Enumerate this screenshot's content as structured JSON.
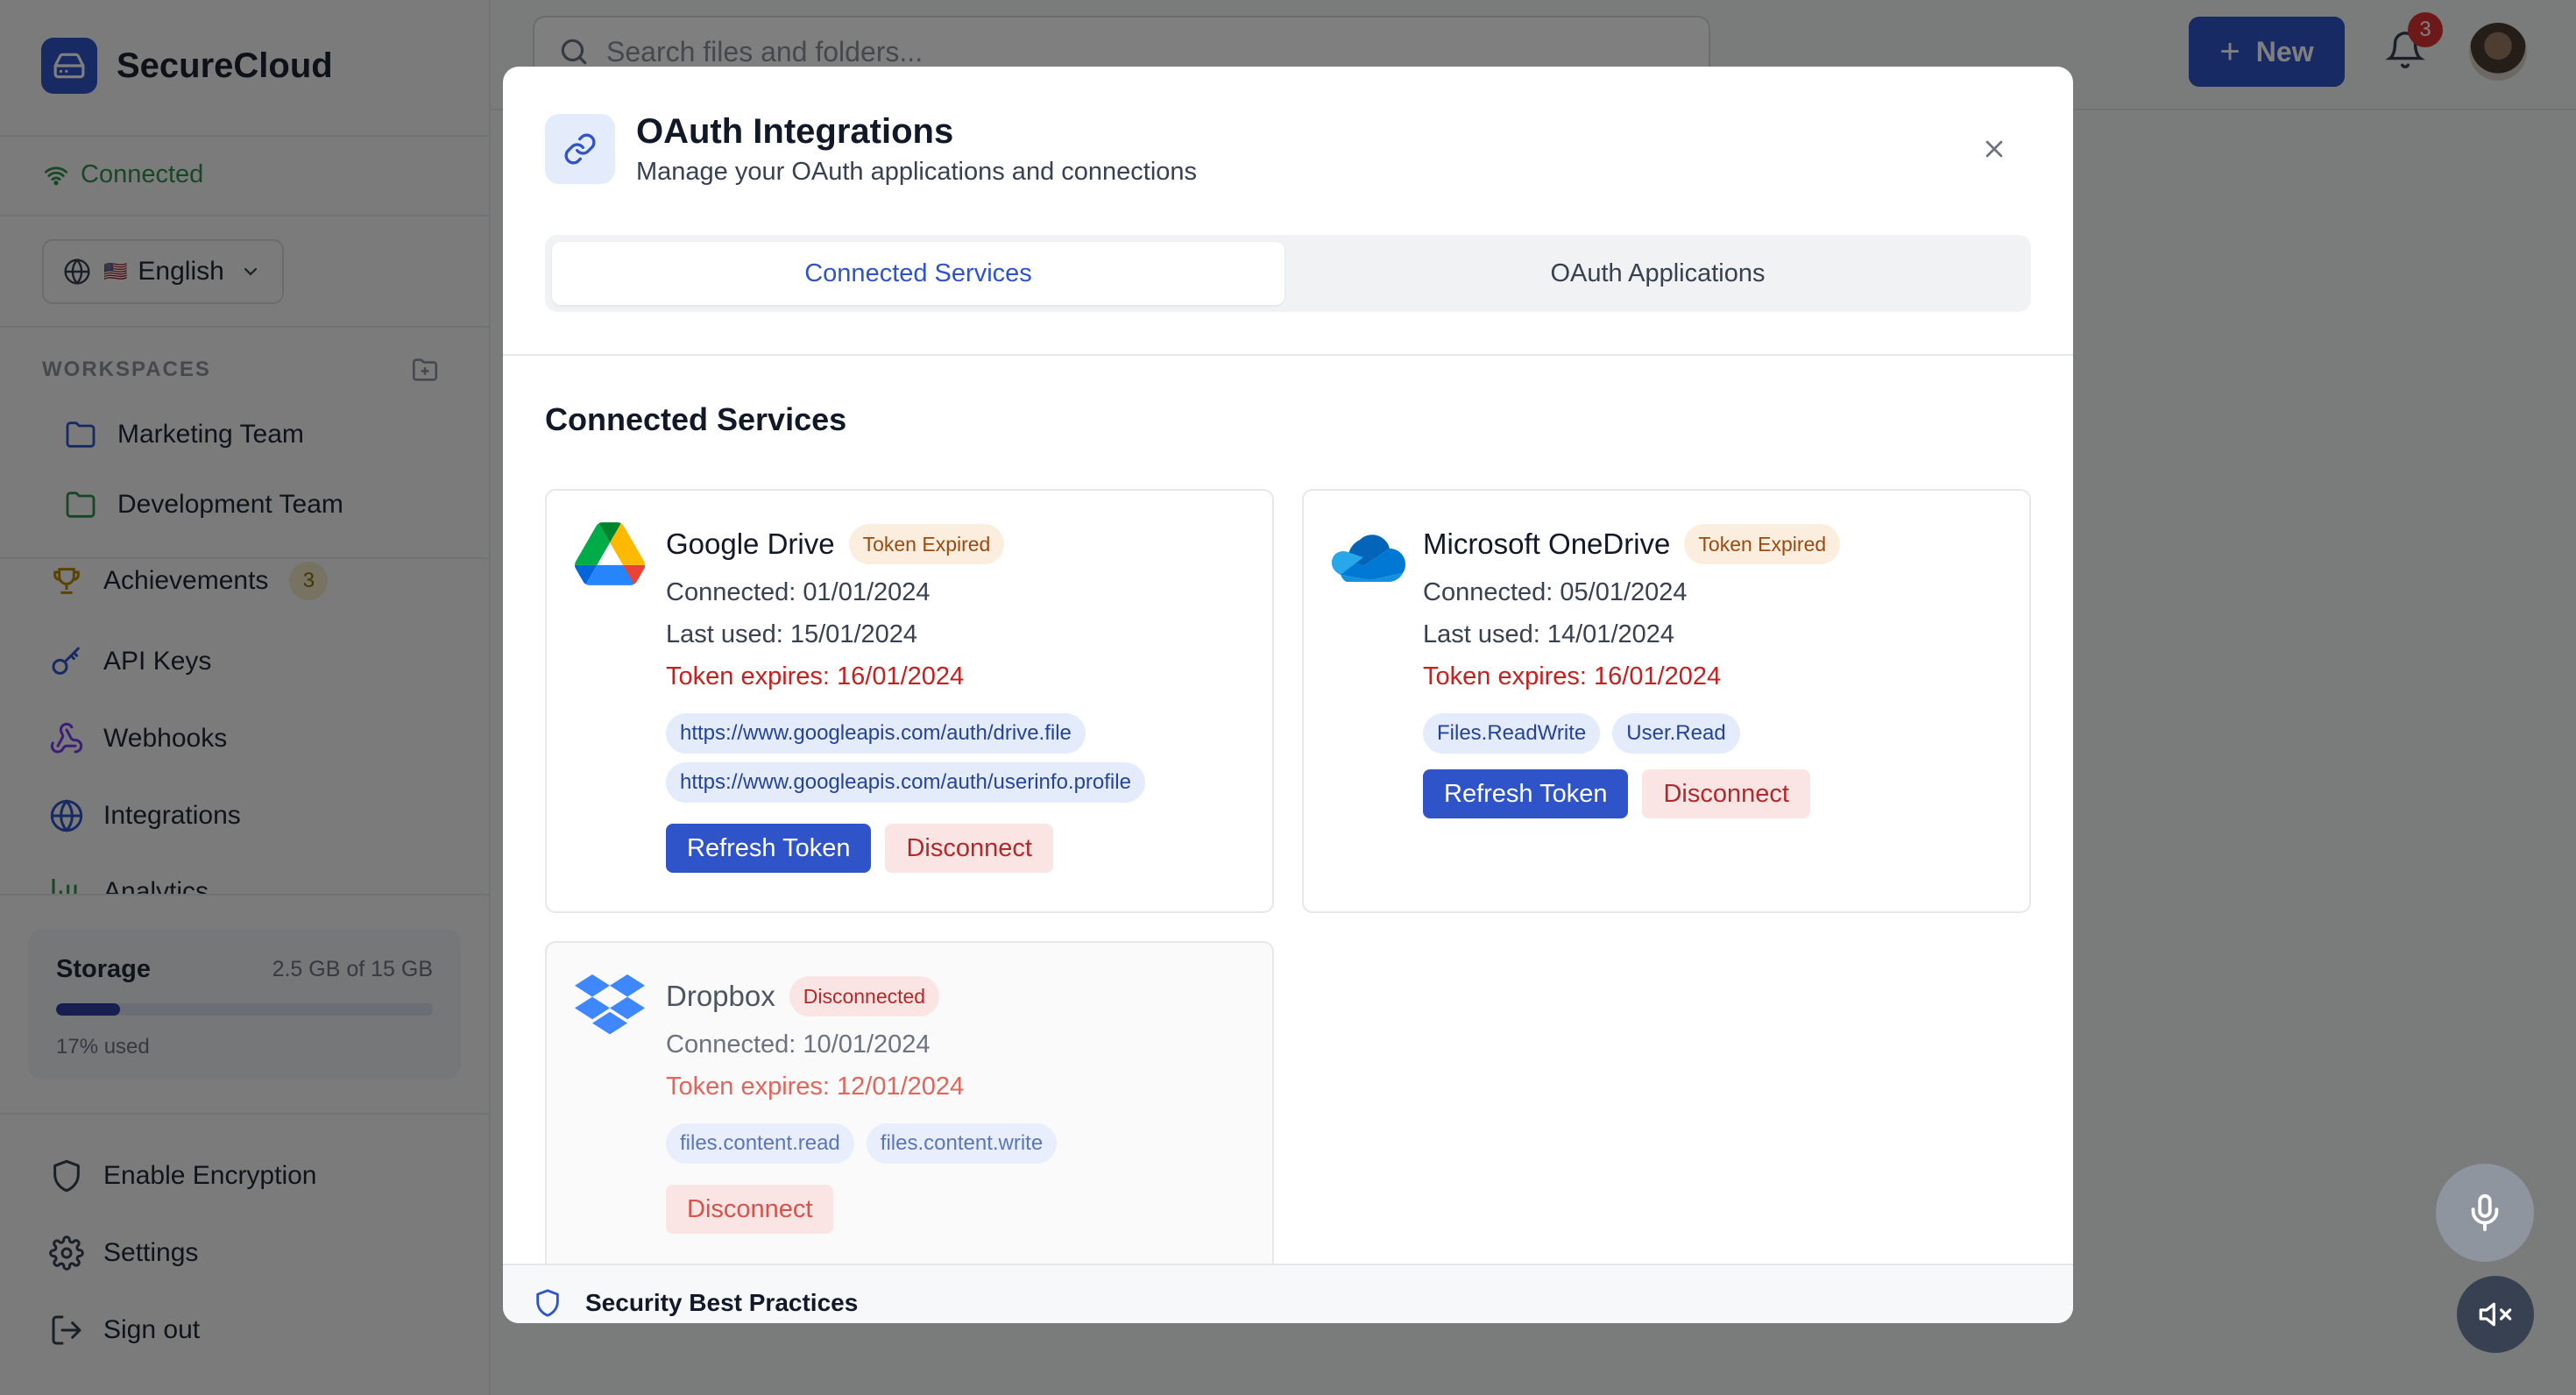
{
  "app": {
    "name": "SecureCloud",
    "connection_status": "Connected"
  },
  "sidebar": {
    "language": {
      "flag": "🇺🇸",
      "label": "English"
    },
    "workspaces_title": "WORKSPACES",
    "workspaces": [
      {
        "label": "Marketing Team",
        "color": "#2f54c9"
      },
      {
        "label": "Development Team",
        "color": "#2f8f4a"
      }
    ],
    "nav": [
      {
        "label": "Achievements",
        "badge": "3",
        "icon": "trophy-icon"
      },
      {
        "label": "API Keys",
        "icon": "key-icon"
      },
      {
        "label": "Webhooks",
        "icon": "webhook-icon"
      },
      {
        "label": "Integrations",
        "icon": "globe-icon"
      },
      {
        "label": "Analytics",
        "icon": "chart-icon"
      }
    ],
    "storage": {
      "title": "Storage",
      "amount": "2.5 GB of 15 GB",
      "percent_label": "17% used",
      "fraction": 0.17
    },
    "bottom": [
      {
        "label": "Enable Encryption",
        "icon": "shield-icon"
      },
      {
        "label": "Settings",
        "icon": "gear-icon"
      },
      {
        "label": "Sign out",
        "icon": "sign-out-icon"
      }
    ]
  },
  "topbar": {
    "search_placeholder": "Search files and folders...",
    "new_label": "New",
    "notifications_count": "3"
  },
  "modal": {
    "title": "OAuth Integrations",
    "subtitle": "Manage your OAuth applications and connections",
    "tabs": [
      {
        "label": "Connected Services",
        "active": true
      },
      {
        "label": "OAuth Applications",
        "active": false
      }
    ],
    "section_title": "Connected Services",
    "services": [
      {
        "name": "Google Drive",
        "status": "Token Expired",
        "connected": "Connected: 01/01/2024",
        "last_used": "Last used: 15/01/2024",
        "expires": "Token expires: 16/01/2024",
        "scopes": [
          "https://www.googleapis.com/auth/drive.file",
          "https://www.googleapis.com/auth/userinfo.profile"
        ],
        "refresh_label": "Refresh Token",
        "disconnect_label": "Disconnect"
      },
      {
        "name": "Microsoft OneDrive",
        "status": "Token Expired",
        "connected": "Connected: 05/01/2024",
        "last_used": "Last used: 14/01/2024",
        "expires": "Token expires: 16/01/2024",
        "scopes": [
          "Files.ReadWrite",
          "User.Read"
        ],
        "refresh_label": "Refresh Token",
        "disconnect_label": "Disconnect"
      },
      {
        "name": "Dropbox",
        "status": "Disconnected",
        "connected": "Connected: 10/01/2024",
        "expires": "Token expires: 12/01/2024",
        "scopes": [
          "files.content.read",
          "files.content.write"
        ],
        "disconnect_label": "Disconnect"
      }
    ],
    "footer_title": "Security Best Practices"
  },
  "colors": {
    "accent": "#2f54c9",
    "danger": "#c81e1e",
    "success": "#2f8f4a",
    "warning_bg": "#fbeede"
  }
}
